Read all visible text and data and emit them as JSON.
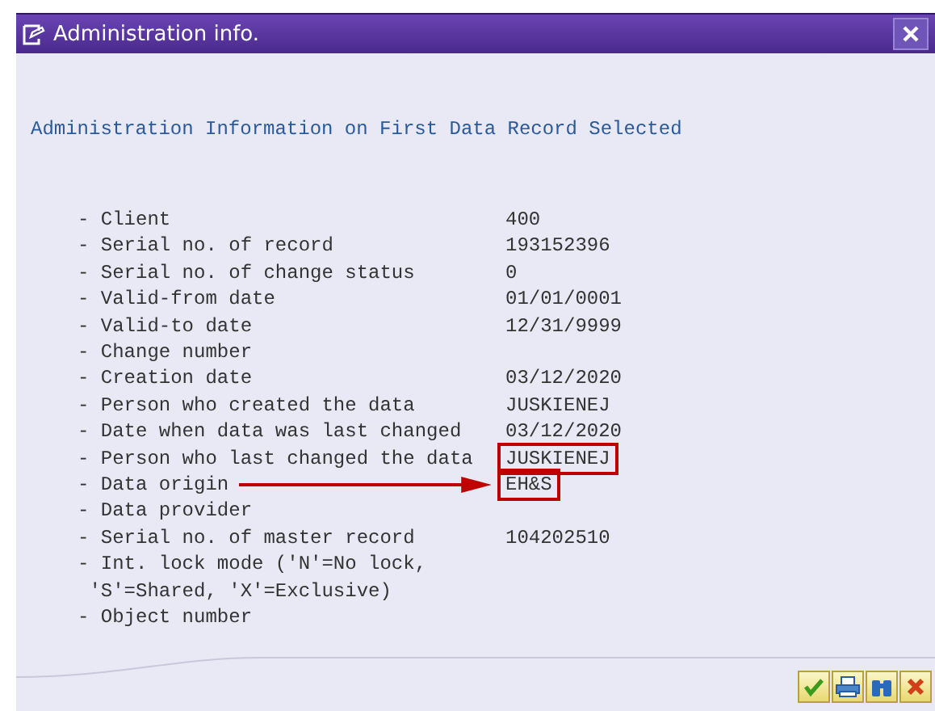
{
  "window": {
    "title": "Administration info."
  },
  "heading": "Administration Information on First Data Record Selected",
  "rows": [
    {
      "label": "- Client",
      "value": "400",
      "highlighted": false,
      "arrow": false
    },
    {
      "label": "- Serial no. of record",
      "value": "193152396",
      "highlighted": false,
      "arrow": false
    },
    {
      "label": "- Serial no. of change status",
      "value": "0",
      "highlighted": false,
      "arrow": false
    },
    {
      "label": "- Valid-from date",
      "value": "01/01/0001",
      "highlighted": false,
      "arrow": false
    },
    {
      "label": "- Valid-to date",
      "value": "12/31/9999",
      "highlighted": false,
      "arrow": false
    },
    {
      "label": "- Change number",
      "arrow": false
    },
    {
      "label": "- Creation date",
      "value": "03/12/2020",
      "highlighted": false,
      "arrow": false
    },
    {
      "label": "- Person who created the data",
      "value": "JUSKIENEJ",
      "highlighted": false,
      "arrow": false
    },
    {
      "label": "- Date when data was last changed",
      "value": "03/12/2020",
      "highlighted": false,
      "arrow": false
    },
    {
      "label": "- Person who last changed the data",
      "value": "JUSKIENEJ",
      "highlighted": true,
      "arrow": false
    },
    {
      "label": "- Data origin",
      "value": "EH&S",
      "highlighted": true,
      "arrow": true
    },
    {
      "label": "- Data provider",
      "arrow": false
    },
    {
      "label": "- Serial no. of master record",
      "value": "104202510",
      "highlighted": false,
      "arrow": false
    },
    {
      "label": "- Int. lock mode ('N'=No lock,\n 'S'=Shared, 'X'=Exclusive)",
      "arrow": false
    },
    {
      "label": "- Object number",
      "arrow": false
    }
  ],
  "buttons": [
    {
      "kind": "confirm"
    },
    {
      "kind": "print"
    },
    {
      "kind": "find"
    },
    {
      "kind": "cancel"
    }
  ]
}
